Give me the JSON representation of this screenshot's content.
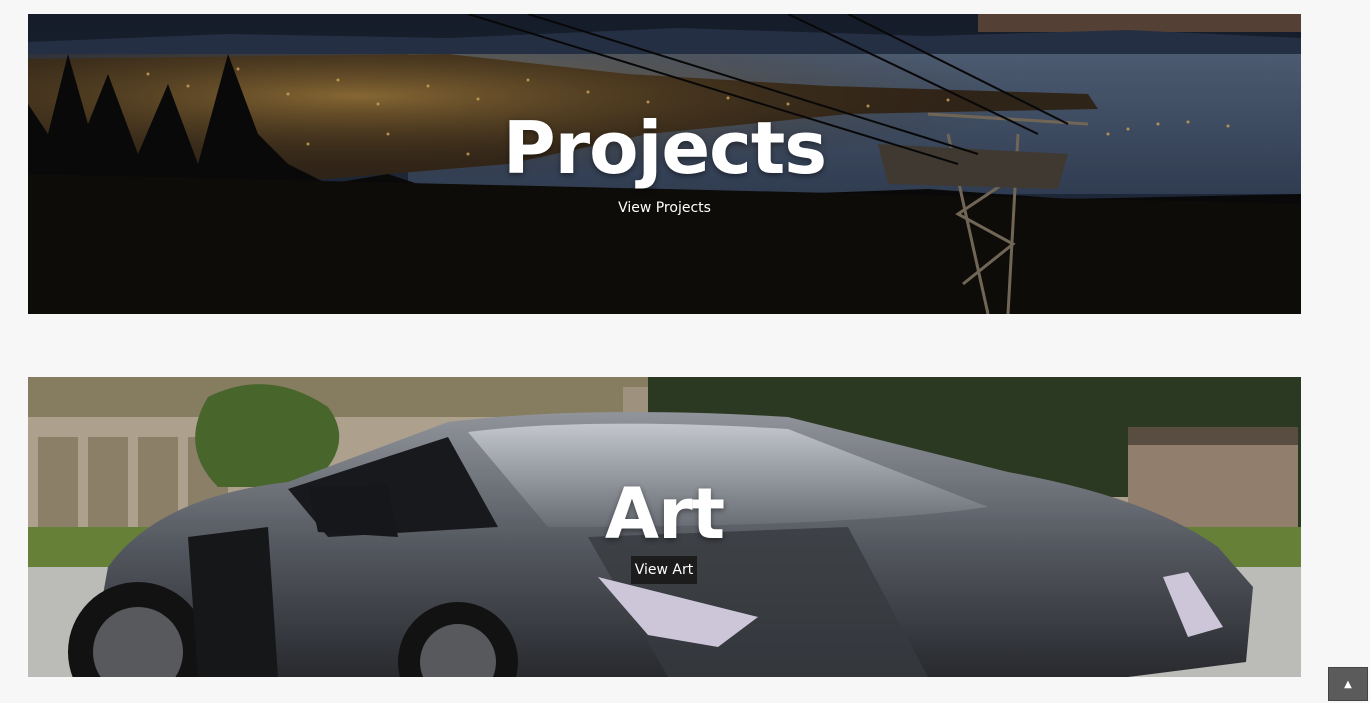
{
  "sections": {
    "projects": {
      "title": "Projects",
      "link_label": "View Projects"
    },
    "art": {
      "title": "Art",
      "button_label": "View Art"
    }
  },
  "scroll_top": {
    "icon": "caret-up-icon",
    "glyph": "▲"
  },
  "colors": {
    "page_background": "#f7f7f7",
    "button_background": "#1c1c1c",
    "scroll_button_background": "#5b5b5b"
  }
}
